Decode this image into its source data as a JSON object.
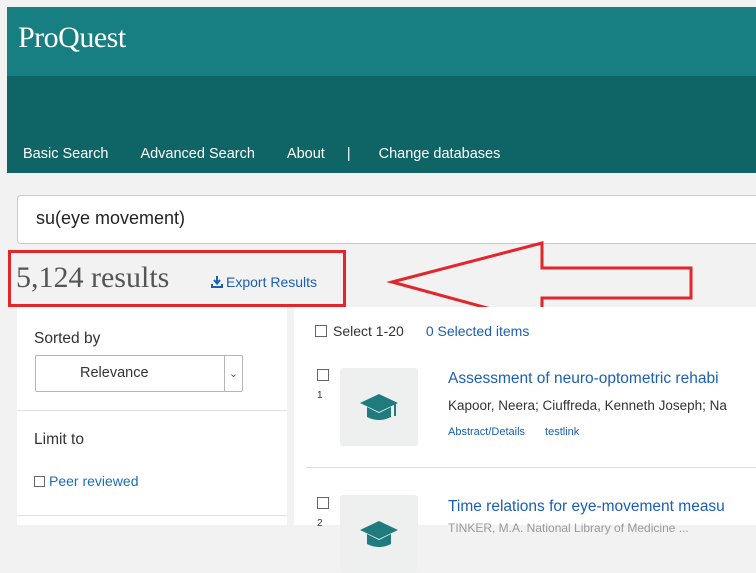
{
  "header": {
    "logo": "ProQuest",
    "nav": [
      "Basic Search",
      "Advanced Search",
      "About",
      "|",
      "Change databases"
    ]
  },
  "search": {
    "value": "su(eye movement)"
  },
  "results": {
    "count_label": "5,124 results",
    "export_label": "Export Results"
  },
  "sidebar": {
    "sorted_by_label": "Sorted by",
    "sort_value": "Relevance",
    "limit_to_label": "Limit to",
    "peer_reviewed_label": "Peer reviewed"
  },
  "main": {
    "select_label": "Select 1-20",
    "selected_items_label": "0 Selected items",
    "items": [
      {
        "number": "1",
        "title": "Assessment of neuro-optometric rehabi",
        "authors": "Kapoor, Neera; Ciuffreda, Kenneth Joseph; Na",
        "links": [
          "Abstract/Details",
          "testlink"
        ]
      },
      {
        "number": "2",
        "title": "Time relations for eye-movement measu",
        "authors": "TINKER, M.A. National Library of Medicine ..."
      }
    ]
  },
  "colors": {
    "header": "#177e81",
    "nav_band": "#0f6466",
    "link": "#1a5fb4",
    "highlight": "#e3262b"
  },
  "icons": [
    "download-icon",
    "chevron-down-icon",
    "mortarboard-icon"
  ]
}
